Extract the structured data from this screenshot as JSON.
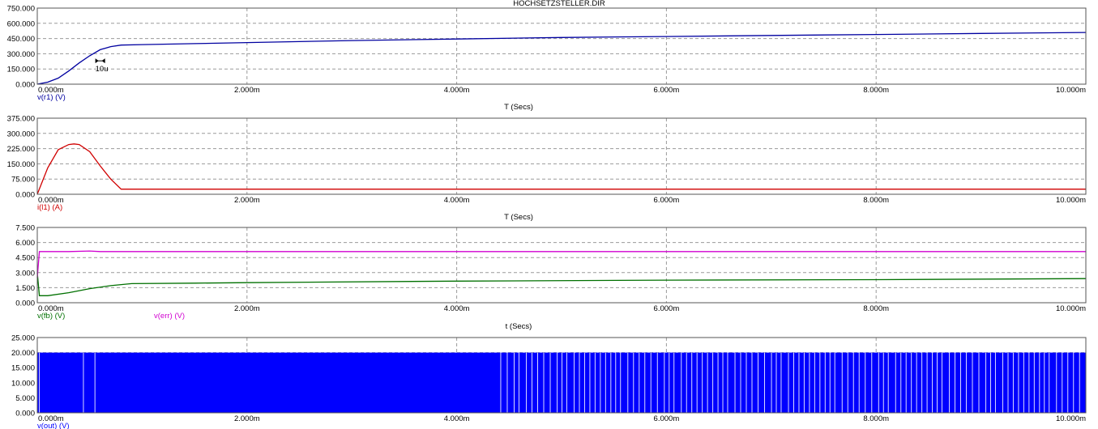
{
  "window": {
    "title": "HOCHSETZSTELLER.DIR"
  },
  "chart_data": [
    {
      "type": "line",
      "xlabel": "T (Secs)",
      "x_ticks": [
        "0.000m",
        "2.000m",
        "4.000m",
        "6.000m",
        "8.000m",
        "10.000m"
      ],
      "xlim": [
        0,
        10
      ],
      "ylim": [
        0,
        750
      ],
      "y_ticks": [
        "0.000",
        "150.000",
        "300.000",
        "450.000",
        "600.000",
        "750.000"
      ],
      "grid": true,
      "annotation": "10u",
      "series": [
        {
          "name": "v(r1) (V)",
          "color": "#0000a0",
          "x": [
            0,
            0.1,
            0.2,
            0.3,
            0.4,
            0.5,
            0.6,
            0.7,
            0.8,
            1,
            1.5,
            2,
            3,
            4,
            5,
            6,
            7,
            8,
            9,
            10
          ],
          "y": [
            0,
            20,
            60,
            130,
            210,
            280,
            340,
            370,
            385,
            390,
            400,
            410,
            430,
            445,
            460,
            470,
            480,
            490,
            500,
            510
          ]
        }
      ]
    },
    {
      "type": "line",
      "xlabel": "T (Secs)",
      "x_ticks": [
        "0.000m",
        "2.000m",
        "4.000m",
        "6.000m",
        "8.000m",
        "10.000m"
      ],
      "xlim": [
        0,
        10
      ],
      "ylim": [
        0,
        375
      ],
      "y_ticks": [
        "0.000",
        "75.000",
        "150.000",
        "225.000",
        "300.000",
        "375.000"
      ],
      "grid": true,
      "series": [
        {
          "name": "i(l1) (A)",
          "color": "#d00000",
          "x": [
            0,
            0.1,
            0.2,
            0.3,
            0.35,
            0.4,
            0.5,
            0.6,
            0.7,
            0.8,
            0.9,
            10
          ],
          "y": [
            0,
            130,
            220,
            245,
            248,
            245,
            210,
            140,
            75,
            25,
            25,
            25
          ]
        }
      ]
    },
    {
      "type": "line",
      "xlabel": "t (Secs)",
      "x_ticks": [
        "0.000m",
        "2.000m",
        "4.000m",
        "6.000m",
        "8.000m",
        "10.000m"
      ],
      "xlim": [
        0,
        10
      ],
      "ylim": [
        0,
        7.5
      ],
      "y_ticks": [
        "0.000",
        "1.500",
        "3.000",
        "4.500",
        "6.000",
        "7.500"
      ],
      "grid": true,
      "series": [
        {
          "name": "v(fb) (V)",
          "color": "#007000",
          "x": [
            0,
            0.02,
            0.1,
            0.3,
            0.5,
            0.7,
            0.9,
            1.5,
            2,
            4,
            6,
            8,
            10
          ],
          "y": [
            3,
            0.7,
            0.7,
            1.0,
            1.4,
            1.7,
            1.9,
            1.95,
            2.0,
            2.15,
            2.25,
            2.3,
            2.4
          ]
        },
        {
          "name": "v(err) (V)",
          "color": "#d000d0",
          "x": [
            0,
            0.02,
            0.3,
            0.5,
            0.6,
            1.0,
            10
          ],
          "y": [
            2.5,
            5.1,
            5.1,
            5.15,
            5.1,
            5.1,
            5.1
          ]
        }
      ]
    },
    {
      "type": "area",
      "xlabel": "",
      "x_ticks": [
        "0.000m",
        "2.000m",
        "4.000m",
        "6.000m",
        "8.000m",
        "10.000m"
      ],
      "xlim": [
        0,
        10
      ],
      "ylim": [
        0,
        25
      ],
      "y_ticks": [
        "0.000",
        "5.000",
        "10.000",
        "15.000",
        "20.000",
        "25.000"
      ],
      "grid": true,
      "series": [
        {
          "name": "v(out) (V)",
          "color": "#0000ff",
          "x": [
            0,
            10
          ],
          "y": [
            20,
            20
          ]
        }
      ]
    }
  ]
}
